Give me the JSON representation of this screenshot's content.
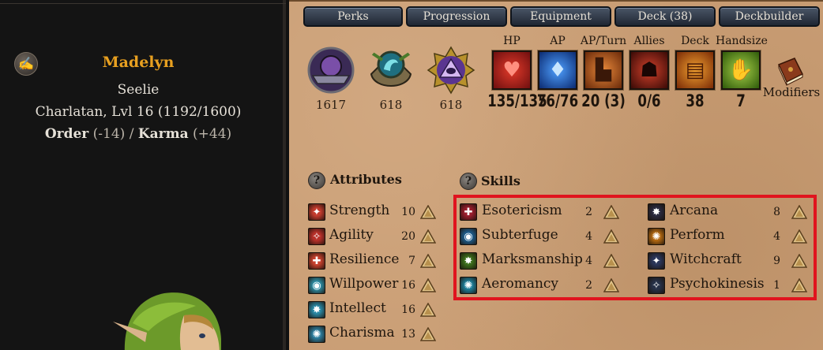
{
  "character": {
    "name": "Madelyn",
    "race": "Seelie",
    "class_line": "Charlatan, Lvl 16 (1192/1600)",
    "order_label": "Order",
    "order_mod": "(-14)",
    "separator": "/",
    "karma_label": "Karma",
    "karma_mod": "(+44)"
  },
  "tabs": [
    "Perks",
    "Progression",
    "Equipment",
    "Deck (38)",
    "Deckbuilder"
  ],
  "emblems": [
    {
      "value": "1617",
      "icon": "purple-shield-emblem"
    },
    {
      "value": "618",
      "icon": "dragon-emblem"
    },
    {
      "value": "618",
      "icon": "all-seeing-eye-emblem"
    }
  ],
  "stats": [
    {
      "label": "HP",
      "value": "135/135",
      "icon": "heart-icon",
      "color": "#b3191d"
    },
    {
      "label": "AP",
      "value": "76/76",
      "icon": "blue-flame-icon",
      "color": "#1f5fc7"
    },
    {
      "label": "AP/Turn",
      "value": "20 (3)",
      "icon": "boot-icon",
      "color": "#c05a1a"
    },
    {
      "label": "Allies",
      "value": "0/6",
      "icon": "helmet-icon",
      "color": "#8f1a14"
    },
    {
      "label": "Deck",
      "value": "38",
      "icon": "cards-icon",
      "color": "#c8710f"
    },
    {
      "label": "Handsize",
      "value": "7",
      "icon": "hand-icon",
      "color": "#5f9a22"
    }
  ],
  "modifiers": {
    "label": "Modifiers",
    "icon": "book-icon"
  },
  "attributes": {
    "title": "Attributes",
    "items": [
      {
        "label": "Strength",
        "value": "10",
        "color": "#c23b2d"
      },
      {
        "label": "Agility",
        "value": "20",
        "color": "#b8302a"
      },
      {
        "label": "Resilience",
        "value": "7",
        "color": "#c8412e"
      },
      {
        "label": "Willpower",
        "value": "16",
        "color": "#2f8fa6"
      },
      {
        "label": "Intellect",
        "value": "16",
        "color": "#2a88a4"
      },
      {
        "label": "Charisma",
        "value": "13",
        "color": "#2d7fa0"
      }
    ]
  },
  "skills": {
    "title": "Skills",
    "left": [
      {
        "label": "Esotericism",
        "value": "2",
        "color": "#9a1d2d"
      },
      {
        "label": "Subterfuge",
        "value": "4",
        "color": "#1f5f8f"
      },
      {
        "label": "Marksmanship",
        "value": "4",
        "color": "#3b6e1c"
      },
      {
        "label": "Aeromancy",
        "value": "2",
        "color": "#1e7f9a"
      }
    ],
    "right": [
      {
        "label": "Arcana",
        "value": "8",
        "color": "#2a2a3e"
      },
      {
        "label": "Perform",
        "value": "4",
        "color": "#b56a12"
      },
      {
        "label": "Witchcraft",
        "value": "9",
        "color": "#2a3558"
      },
      {
        "label": "Psychokinesis",
        "value": "1",
        "color": "#263047"
      }
    ]
  },
  "colors": {
    "highlight": "#e0141e",
    "name": "#e8a020",
    "parchment": "#c99d74"
  }
}
